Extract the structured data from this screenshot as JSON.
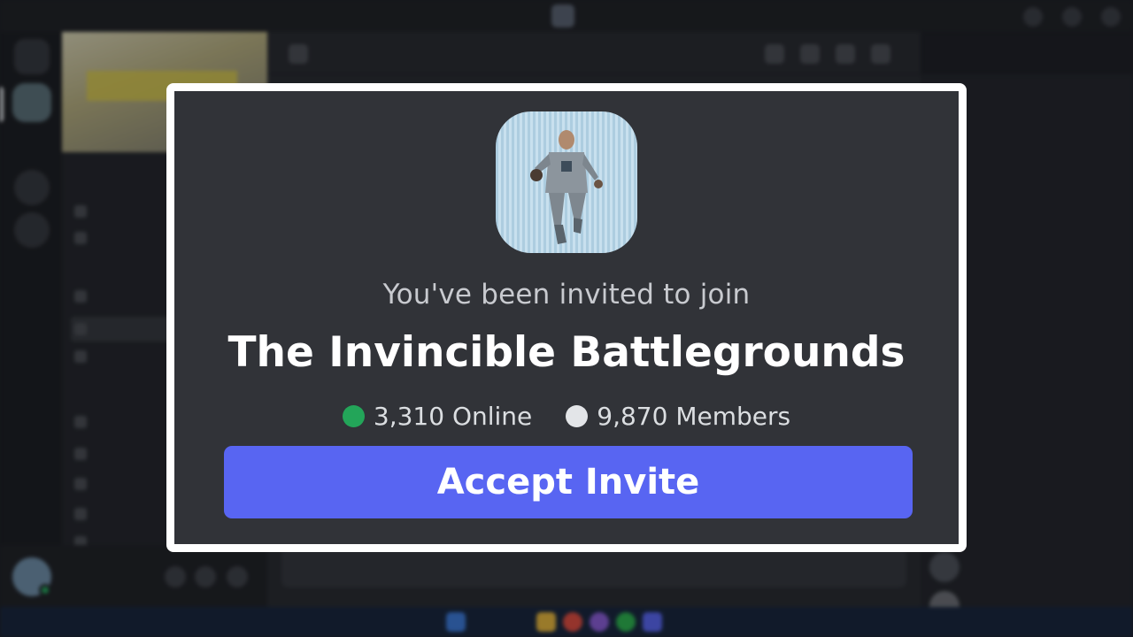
{
  "colors": {
    "card_background": "#313338",
    "card_border": "#ffffff",
    "accent_button": "#5865f2",
    "online_dot": "#23a559",
    "members_dot": "#e3e5e8"
  },
  "invite": {
    "subtitle": "You've been invited to join",
    "server_name": "The Invincible Battlegrounds",
    "server_icon": "invincible-hero-flying-icon",
    "stats": {
      "online": "3,310 Online",
      "members": "9,870 Members"
    },
    "accept_label": "Accept Invite"
  }
}
